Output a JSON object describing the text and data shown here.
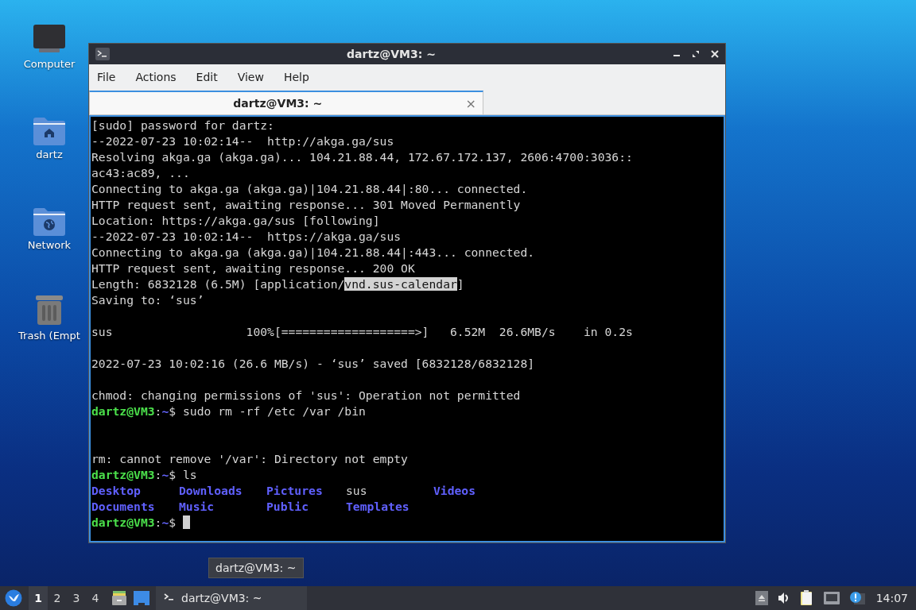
{
  "desktop_icons": [
    {
      "label": "Computer",
      "kind": "computer"
    },
    {
      "label": "dartz",
      "kind": "home"
    },
    {
      "label": "Network",
      "kind": "network"
    },
    {
      "label": "Trash (Empt",
      "kind": "trash"
    }
  ],
  "window": {
    "title": "dartz@VM3: ~",
    "menu": [
      "File",
      "Actions",
      "Edit",
      "View",
      "Help"
    ],
    "tabs": [
      {
        "label": "dartz@VM3: ~",
        "selected": true,
        "close": "×"
      }
    ],
    "terminal": {
      "lines": [
        {
          "kind": "text",
          "text": "[sudo] password for dartz:"
        },
        {
          "kind": "text",
          "text": "--2022-07-23 10:02:14--  http://akga.ga/sus"
        },
        {
          "kind": "text",
          "text": "Resolving akga.ga (akga.ga)... 104.21.88.44, 172.67.172.137, 2606:4700:3036::"
        },
        {
          "kind": "text",
          "text": "ac43:ac89, ..."
        },
        {
          "kind": "text",
          "text": "Connecting to akga.ga (akga.ga)|104.21.88.44|:80... connected."
        },
        {
          "kind": "text",
          "text": "HTTP request sent, awaiting response... 301 Moved Permanently"
        },
        {
          "kind": "text",
          "text": "Location: https://akga.ga/sus [following]"
        },
        {
          "kind": "text",
          "text": "--2022-07-23 10:02:14--  https://akga.ga/sus"
        },
        {
          "kind": "text",
          "text": "Connecting to akga.ga (akga.ga)|104.21.88.44|:443... connected."
        },
        {
          "kind": "text",
          "text": "HTTP request sent, awaiting response... 200 OK"
        },
        {
          "kind": "segments",
          "segments": [
            {
              "text": "Length: 6832128 (6.5M) [application/",
              "selected": false
            },
            {
              "text": "vnd.sus-calendar",
              "selected": true
            },
            {
              "text": "]",
              "selected": false
            }
          ]
        },
        {
          "kind": "text",
          "text": "Saving to: ‘sus’"
        },
        {
          "kind": "blank"
        },
        {
          "kind": "text",
          "text": "sus                   100%[===================>]   6.52M  26.6MB/s    in 0.2s"
        },
        {
          "kind": "blank"
        },
        {
          "kind": "text",
          "text": "2022-07-23 10:02:16 (26.6 MB/s) - ‘sus’ saved [6832128/6832128]"
        },
        {
          "kind": "blank"
        },
        {
          "kind": "text",
          "text": "chmod: changing permissions of 'sus': Operation not permitted"
        },
        {
          "kind": "prompt",
          "user": "dartz@VM3",
          "sep": ":",
          "path": "~",
          "symbol": "$",
          "command": "sudo rm -rf /etc /var /bin"
        },
        {
          "kind": "blank"
        },
        {
          "kind": "blank"
        },
        {
          "kind": "text",
          "text": "rm: cannot remove '/var': Directory not empty"
        },
        {
          "kind": "prompt",
          "user": "dartz@VM3",
          "sep": ":",
          "path": "~",
          "symbol": "$",
          "command": "ls"
        },
        {
          "kind": "listing",
          "entries": [
            {
              "name": "Desktop",
              "kind": "dir"
            },
            {
              "name": "Downloads",
              "kind": "dir"
            },
            {
              "name": "Pictures",
              "kind": "dir"
            },
            {
              "name": "sus",
              "kind": "file"
            },
            {
              "name": "Videos",
              "kind": "dir"
            }
          ]
        },
        {
          "kind": "listing",
          "entries": [
            {
              "name": "Documents",
              "kind": "dir"
            },
            {
              "name": "Music",
              "kind": "dir"
            },
            {
              "name": "Public",
              "kind": "dir"
            },
            {
              "name": "Templates",
              "kind": "dir"
            }
          ]
        },
        {
          "kind": "prompt",
          "user": "dartz@VM3",
          "sep": ":",
          "path": "~",
          "symbol": "$",
          "cursor": true
        }
      ]
    }
  },
  "taskbar": {
    "workspaces": [
      {
        "label": "1",
        "selected": true
      },
      {
        "label": "2",
        "selected": false
      },
      {
        "label": "3",
        "selected": false
      },
      {
        "label": "4",
        "selected": false
      }
    ],
    "tasks": [
      {
        "label": "dartz@VM3: ~",
        "selected": false
      }
    ],
    "tooltip": "dartz@VM3: ~",
    "clock": "14:07"
  }
}
